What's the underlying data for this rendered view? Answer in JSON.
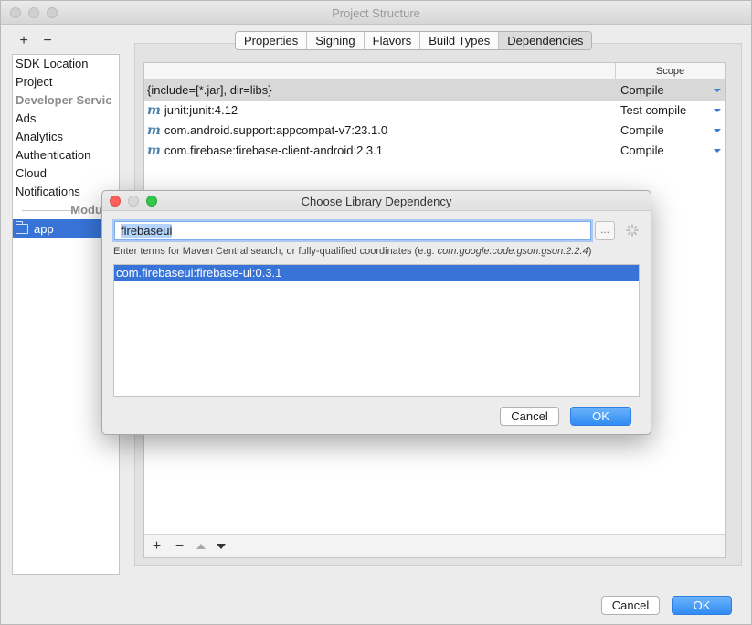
{
  "window": {
    "title": "Project Structure"
  },
  "sidebar": {
    "add_label": "+",
    "remove_label": "−",
    "items": [
      {
        "label": "SDK Location"
      },
      {
        "label": "Project"
      }
    ],
    "developer_services_header": "Developer Servic",
    "services": [
      {
        "label": "Ads"
      },
      {
        "label": "Analytics"
      },
      {
        "label": "Authentication"
      },
      {
        "label": "Cloud"
      },
      {
        "label": "Notifications"
      }
    ],
    "modules_header": "Modules",
    "modules": [
      {
        "label": "app"
      }
    ]
  },
  "tabs": [
    "Properties",
    "Signing",
    "Flavors",
    "Build Types",
    "Dependencies"
  ],
  "active_tab": "Dependencies",
  "dependencies": {
    "scope_header": "Scope",
    "rows": [
      {
        "name": "{include=[*.jar], dir=libs}",
        "scope": "Compile",
        "maven": false
      },
      {
        "name": "junit:junit:4.12",
        "scope": "Test compile",
        "maven": true
      },
      {
        "name": "com.android.support:appcompat-v7:23.1.0",
        "scope": "Compile",
        "maven": true
      },
      {
        "name": "com.firebase:firebase-client-android:2.3.1",
        "scope": "Compile",
        "maven": true
      }
    ],
    "maven_icon": "m"
  },
  "dialog": {
    "title": "Choose Library Dependency",
    "search_value": "firebaseui",
    "more_label": "...",
    "hint_prefix": "Enter terms for Maven Central search, or fully-qualified coordinates (e.g. ",
    "hint_example": "com.google.code.gson:gson:2.2.4",
    "hint_suffix": ")",
    "results": [
      "com.firebaseui:firebase-ui:0.3.1"
    ],
    "cancel_label": "Cancel",
    "ok_label": "OK"
  },
  "footer": {
    "cancel_label": "Cancel",
    "ok_label": "OK"
  },
  "colors": {
    "accent": "#3874d8",
    "primary_button": "#2f8cf3",
    "close": "#fc605b",
    "minimize": "#d8d8d8",
    "zoom": "#34c84a"
  }
}
